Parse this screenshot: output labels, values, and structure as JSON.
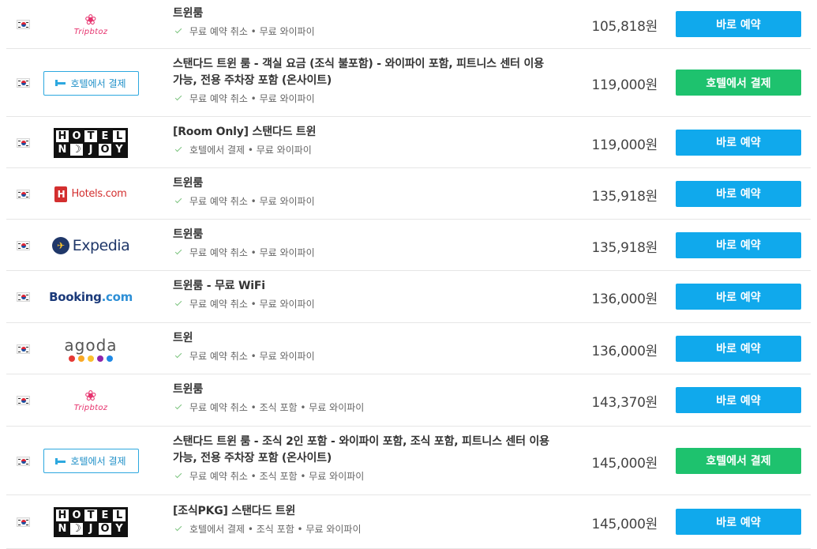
{
  "rows": [
    {
      "logo": "tripbtoz",
      "logo_text": "Tripbtoz",
      "title": "트윈룸",
      "features": "무료 예약 취소 • 무료 와이파이",
      "price": "105,818원",
      "button": "바로 예약",
      "button_color": "blue"
    },
    {
      "logo": "pay-at-hotel",
      "logo_text": "호텔에서 결제",
      "title": "스탠다드 트윈 룸 - 객실 요금 (조식 불포함) - 와이파이 포함, 피트니스 센터 이용 가능, 전용 주차장 포함 (온사이트)",
      "features": "무료 예약 취소 • 무료 와이파이",
      "price": "119,000원",
      "button": "호텔에서 결제",
      "button_color": "green"
    },
    {
      "logo": "hotelnjoy",
      "logo_text": "HOTELNJOY",
      "title": "[Room Only] 스탠다드 트윈",
      "features": "호텔에서 결제 • 무료 와이파이",
      "price": "119,000원",
      "button": "바로 예약",
      "button_color": "blue"
    },
    {
      "logo": "hotelscom",
      "logo_text": "Hotels.com",
      "title": "트윈룸",
      "features": "무료 예약 취소 • 무료 와이파이",
      "price": "135,918원",
      "button": "바로 예약",
      "button_color": "blue"
    },
    {
      "logo": "expedia",
      "logo_text": "Expedia",
      "title": "트윈룸",
      "features": "무료 예약 취소 • 무료 와이파이",
      "price": "135,918원",
      "button": "바로 예약",
      "button_color": "blue"
    },
    {
      "logo": "booking",
      "logo_text": "Booking",
      "logo_text_suffix": ".com",
      "title": "트윈룸 - 무료 WiFi",
      "features": "무료 예약 취소 • 무료 와이파이",
      "price": "136,000원",
      "button": "바로 예약",
      "button_color": "blue"
    },
    {
      "logo": "agoda",
      "logo_text": "agoda",
      "title": "트윈",
      "features": "무료 예약 취소 • 무료 와이파이",
      "price": "136,000원",
      "button": "바로 예약",
      "button_color": "blue"
    },
    {
      "logo": "tripbtoz",
      "logo_text": "Tripbtoz",
      "title": "트윈룸",
      "features": "무료 예약 취소 • 조식 포함 • 무료 와이파이",
      "price": "143,370원",
      "button": "바로 예약",
      "button_color": "blue"
    },
    {
      "logo": "pay-at-hotel",
      "logo_text": "호텔에서 결제",
      "title": "스탠다드 트윈 룸 - 조식 2인 포함 - 와이파이 포함, 조식 포함, 피트니스 센터 이용 가능, 전용 주차장 포함 (온사이트)",
      "features": "무료 예약 취소 • 조식 포함 • 무료 와이파이",
      "price": "145,000원",
      "button": "호텔에서 결제",
      "button_color": "green"
    },
    {
      "logo": "hotelnjoy",
      "logo_text": "HOTELNJOY",
      "title": "[조식PKG] 스탠다드 트윈",
      "features": "호텔에서 결제 • 조식 포함 • 무료 와이파이",
      "price": "145,000원",
      "button": "바로 예약",
      "button_color": "blue"
    }
  ],
  "colors": {
    "blue_button": "#10a9ec",
    "green_button": "#1ec26e",
    "check": "#7cc47f",
    "agoda_dots": [
      "#e53935",
      "#f9a825",
      "#fbc02d",
      "#8e24aa",
      "#1e88e5"
    ]
  }
}
